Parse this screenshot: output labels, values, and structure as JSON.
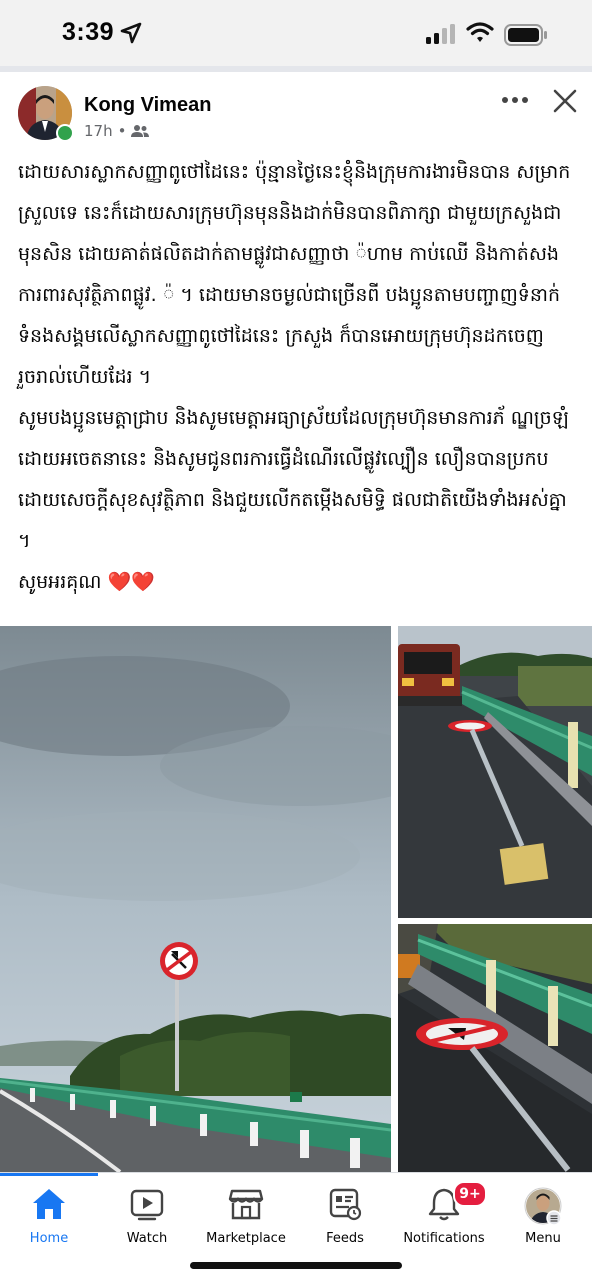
{
  "status_bar": {
    "time": "3:39"
  },
  "post": {
    "author": "Kong Vimean",
    "time_ago": "17h",
    "dot": "•",
    "text": "ដោយសារស្លាកសញ្ញាពូថៅដៃនេះ ប៉ុន្មានថ្ងៃនេះខ្ញុំនិងក្រុមការងារមិនបាន សម្រាកស្រួលទេ នេះក៏ដោយសារក្រុមហ៊ុនមុននិងដាក់មិនបានពិភាក្សា ជាមួយក្រសួងជាមុនសិន ដោយគាត់ផលិតដាក់តាមផ្លូវជាសញ្ញាថា ៉ហាម កាប់ឈើ និងកាត់សងការពារសុវត្ថិភាពផ្លូវ. ៉ ។ ដោយមានចម្ងល់ជាច្រើនពី បងប្អូនតាមបញ្ចាញទំនាក់ទំនងសង្គមលើស្លាកសញ្ញាពូថៅដៃនេះ ក្រសួង ក៏បានអោយក្រុមហ៊ុនដកចេញរួចរាល់ហើយដែរ ។\nសូមបងប្អូនមេត្តាជ្រាប និងសូមមេត្តាអធ្យាស្រ័យដែលក្រុមហ៊ុនមានការភ័ ណ្ឌច្រឡំដោយអចេតនានេះ និងសូមជូនពរការធ្វើដំណើរលើផ្លូវល្បឿន លឿនបានប្រកបដោយសេចក្តីសុខសុវត្ថិភាព និងជួយលើកតម្កើងសមិទ្ធិ ផលជាតិយើងទាំងអស់គ្នា ។",
    "thanks": "សូមអរគុណ",
    "hearts": "❤️❤️"
  },
  "nav": {
    "items": [
      {
        "label": "Home",
        "icon": "home-icon",
        "active": true
      },
      {
        "label": "Watch",
        "icon": "video-icon"
      },
      {
        "label": "Marketplace",
        "icon": "shop-icon"
      },
      {
        "label": "Feeds",
        "icon": "feeds-icon"
      },
      {
        "label": "Notifications",
        "icon": "bell-icon",
        "badge": "9+"
      },
      {
        "label": "Menu",
        "icon": "profile-avatar-icon"
      }
    ]
  },
  "colors": {
    "accent": "#1877f2",
    "badge": "#e41e3f",
    "online": "#31a24c",
    "guardrail": "#2e8b6a",
    "sign_red": "#d9242b"
  }
}
